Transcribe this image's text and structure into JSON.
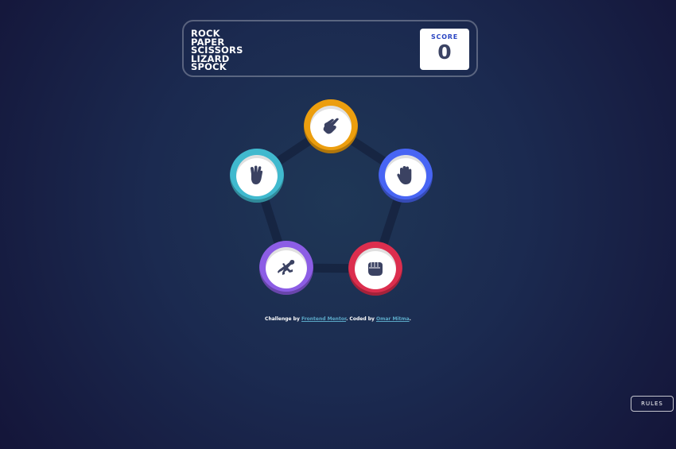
{
  "header": {
    "title_lines": [
      "Rock",
      "Paper",
      "Scissors",
      "Lizard",
      "Spock"
    ],
    "score_label": "SCORE",
    "score_value": "0"
  },
  "tokens": [
    {
      "id": "scissors",
      "icon": "scissors-hand-icon",
      "color": "#ec9e0e"
    },
    {
      "id": "paper",
      "icon": "paper-hand-icon",
      "color": "#4865f4"
    },
    {
      "id": "rock",
      "icon": "rock-fist-icon",
      "color": "#dc2e4e"
    },
    {
      "id": "lizard",
      "icon": "lizard-icon",
      "color": "#8c5de5"
    },
    {
      "id": "spock",
      "icon": "spock-hand-icon",
      "color": "#40b9ce"
    }
  ],
  "footer": {
    "prefix": "Challenge by ",
    "link1": "Frontend Mentor",
    "middle": ". Coded by ",
    "link2": "Omar Mitma",
    "suffix": "."
  },
  "rules_button": "RULES"
}
